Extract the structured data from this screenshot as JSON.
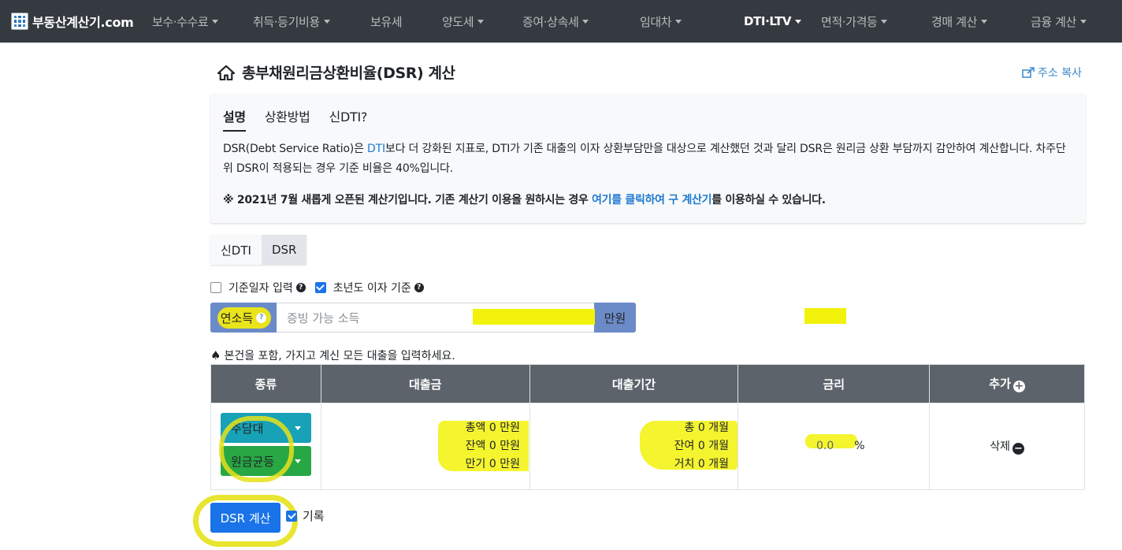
{
  "nav": {
    "brand": "부동산계산기.com",
    "items": [
      {
        "label": "보수·수수료",
        "dropdown": true
      },
      {
        "label": "취득·등기비용",
        "dropdown": true
      },
      {
        "label": "보유세",
        "dropdown": false
      },
      {
        "label": "양도세",
        "dropdown": true
      },
      {
        "label": "증여·상속세",
        "dropdown": true
      },
      {
        "label": "임대차",
        "dropdown": true
      },
      {
        "label": "DTI·LTV",
        "dropdown": true,
        "active": true
      },
      {
        "label": "면적·가격등",
        "dropdown": true
      },
      {
        "label": "경매 계산",
        "dropdown": true
      },
      {
        "label": "금융 계산",
        "dropdown": true
      }
    ]
  },
  "page": {
    "title": "총부채원리금상환비율(DSR) 계산",
    "copy_link": "주소 복사"
  },
  "info": {
    "tabs": [
      "설명",
      "상환방법",
      "신DTI?"
    ],
    "desc_part1": "DSR(Debt Service Ratio)은 ",
    "desc_link": "DTI",
    "desc_part2": "보다 더 강화된 지표로, DTI가 기존 대출의 이자 상환부담만을 대상으로 계산했던 것과 달리 DSR은 원리금 상환 부담까지 감안하여 계산합니다. 차주단위 DSR이 적용되는 경우 기준 비율은 40%입니다.",
    "notice_part1": "※ 2021년 7월 새롭게 오픈된 계산기입니다. 기존 계산기 이용을 원하시는 경우 ",
    "notice_link": "여기를 클릭하여 구 계산기",
    "notice_part2": "를 이용하실 수 있습니다."
  },
  "mode": {
    "options": [
      "신DTI",
      "DSR"
    ],
    "selected": "DSR"
  },
  "options": {
    "base_date_label": "기준일자 입력",
    "base_date_checked": false,
    "first_year_label": "초년도 이자 기준",
    "first_year_checked": true
  },
  "income": {
    "label": "연소득",
    "placeholder": "증빙 가능 소득",
    "unit": "만원"
  },
  "guide": "본건을 포함, 가지고 계신 모든 대출을 입력하세요.",
  "table": {
    "headers": [
      "종류",
      "대출금",
      "대출기간",
      "금리",
      "추가"
    ],
    "rows": [
      {
        "type": "주담대",
        "method": "원금균등",
        "amount_lines": [
          "총액 0 만원",
          "잔액 0 만원",
          "만기 0 만원"
        ],
        "period_lines": [
          "총 0 개월",
          "잔여 0 개월",
          "거치 0 개월"
        ],
        "rate": "0.0",
        "rate_unit": "%",
        "delete_label": "삭제"
      }
    ]
  },
  "actions": {
    "calc_label": "DSR 계산",
    "record_label": "기록",
    "record_checked": true
  },
  "colors": {
    "navbar": "#343a40",
    "accent": "#1a73e8",
    "teal": "#17a2b8",
    "green": "#28a745",
    "table_header": "#5c636b",
    "highlight": "#f2f20b"
  }
}
